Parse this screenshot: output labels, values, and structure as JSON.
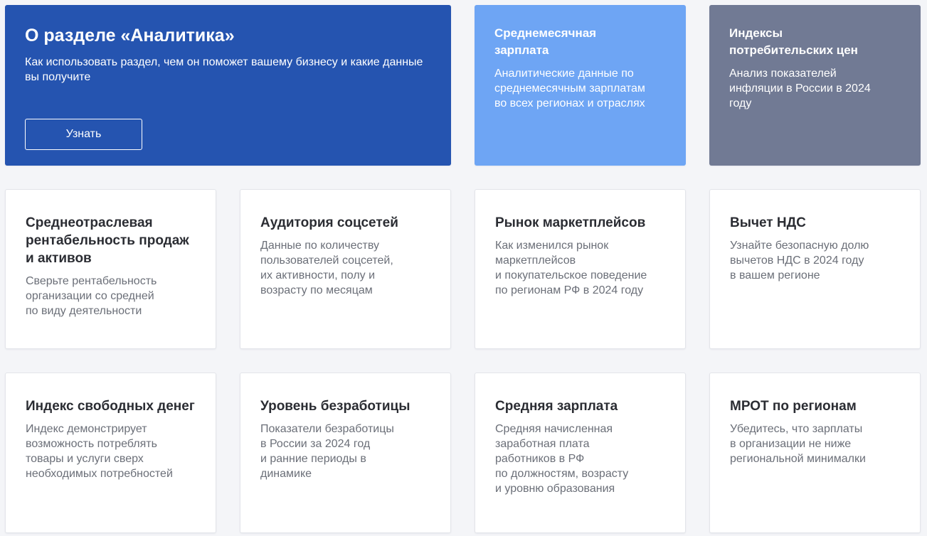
{
  "hero": {
    "title": "О разделе «Аналитика»",
    "description": "Как использовать раздел, чем он поможет вашему бизнесу и какие данные вы получите",
    "button_label": "Узнать",
    "bg_color": "#2554b0"
  },
  "featured": [
    {
      "title": "Среднемесячная\nзарплата",
      "description": "Аналитические данные по\nсреднемесячным зарплатам\nво всех регионах и отраслях",
      "bg_color": "#6ea5f4"
    },
    {
      "title": "Индексы\nпотребительских цен",
      "description": "Анализ показателей\nинфляции в России в 2024\nгоду",
      "bg_color": "#717a94"
    }
  ],
  "cards": [
    {
      "title": "Среднеотраслевая\nрентабельность продаж\nи активов",
      "description": "Сверьте рентабельность\nорганизации со средней\nпо виду деятельности"
    },
    {
      "title": "Аудитория соцсетей",
      "description": "Данные по количеству\nпользователей соцсетей,\nих активности, полу и\nвозрасту по месяцам"
    },
    {
      "title": "Рынок маркетплейсов",
      "description": "Как изменился рынок\nмаркетплейсов\nи покупательское поведение\nпо регионам РФ в 2024 году"
    },
    {
      "title": "Вычет НДС",
      "description": "Узнайте безопасную долю\nвычетов НДС в 2024 году\nв вашем регионе"
    },
    {
      "title": "Индекс свободных денег",
      "description": "Индекс демонстрирует\nвозможность потреблять\nтовары и услуги сверх\nнеобходимых потребностей"
    },
    {
      "title": "Уровень безработицы",
      "description": "Показатели безработицы\nв России за 2024 год\nи ранние периоды в\nдинамике"
    },
    {
      "title": "Средняя зарплата",
      "description": "Средняя начисленная\nзаработная плата\nработников в РФ\nпо должностям, возрасту\nи уровню образования"
    },
    {
      "title": "МРОТ по регионам",
      "description": "Убедитесь, что зарплаты\nв организации не ниже\nрегиональной минималки"
    }
  ]
}
